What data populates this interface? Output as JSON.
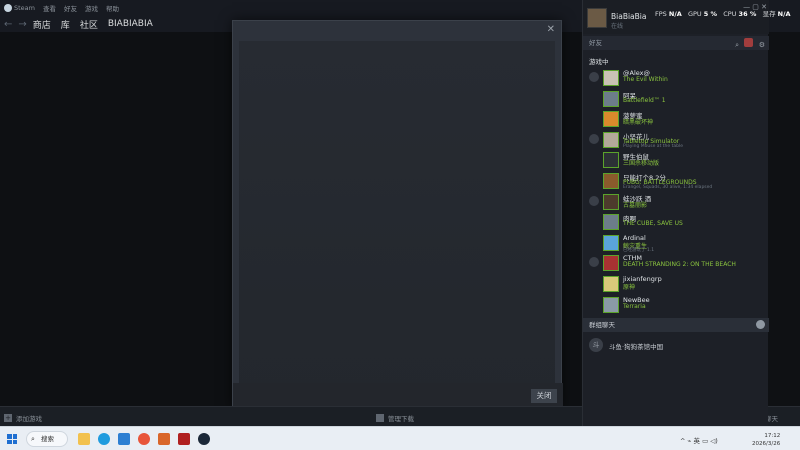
{
  "menubar": {
    "app": "Steam",
    "items": [
      "查看",
      "好友",
      "游戏",
      "帮助"
    ]
  },
  "nav": {
    "store": "商店",
    "library": "库",
    "community": "社区",
    "username": "BIABIABIA"
  },
  "dialog": {
    "close_label": "关闭",
    "close_x": "✕"
  },
  "bottombar": {
    "add_game": "添加游戏",
    "downloads": "管理下载",
    "friends_chat": "聊天"
  },
  "friends_panel": {
    "user_name": "BiaBiaBia",
    "user_status": "在线",
    "fps_label": "FPS",
    "fps_value": "N/A",
    "gpu_label": "GPU",
    "gpu_value": "5 %",
    "cpu_label": "CPU",
    "cpu_value": "36 %",
    "vram_label": "显存",
    "vram_value": "N/A",
    "search_label": "好友",
    "in_game_title": "游戏中",
    "friends": [
      {
        "name": "@Alex@",
        "game": "The Evil Within",
        "sub": "",
        "color": "#c9c2b4"
      },
      {
        "name": "阿呆",
        "game": "Battlefield™ 1",
        "sub": "",
        "color": "#6c7d8a"
      },
      {
        "name": "菠萝蜜",
        "game": "暗黑破坏神",
        "sub": "",
        "color": "#d98a2c"
      },
      {
        "name": "小坚花儿",
        "game": "Tabletop Simulator",
        "sub": "Playing Mouse at the table",
        "color": "#b3a89a"
      },
      {
        "name": "野生伯鼠",
        "game": "三国杀移动版",
        "sub": "",
        "color": "#2c3136"
      },
      {
        "name": "只能打个8.2分",
        "game": "PUBG: BATTLEGROUNDS",
        "sub": "Erangel, Squads, 30 alive, 1:34 elapsed",
        "color": "#8a5a2c"
      },
      {
        "name": "蛙沙跃 酒",
        "game": "古墓丽影",
        "sub": "",
        "color": "#4d3b2c"
      },
      {
        "name": "肉啊",
        "game": "THE CUBE, SAVE US",
        "sub": "",
        "color": "#6c7d8a"
      },
      {
        "name": "Ardinal",
        "game": "鲸灾重生",
        "sub": "已经游玩了 1.1",
        "color": "#5aa4d9"
      },
      {
        "name": "CTHM",
        "game": "DEATH STRANDING 2: ON THE BEACH",
        "sub": "",
        "color": "#a83232"
      },
      {
        "name": "jixianfengrp",
        "game": "原神",
        "sub": "",
        "color": "#d9c97a"
      },
      {
        "name": "NewBee",
        "game": "Terraria",
        "sub": "",
        "color": "#8a9aa6"
      }
    ],
    "groupchat_title": "群组聊天",
    "groupchat_name": "斗鱼·狗狗茶馆中国"
  },
  "taskbar": {
    "search": "搜索",
    "tray": "英",
    "time": "17:12",
    "date": "2026/3/26"
  }
}
